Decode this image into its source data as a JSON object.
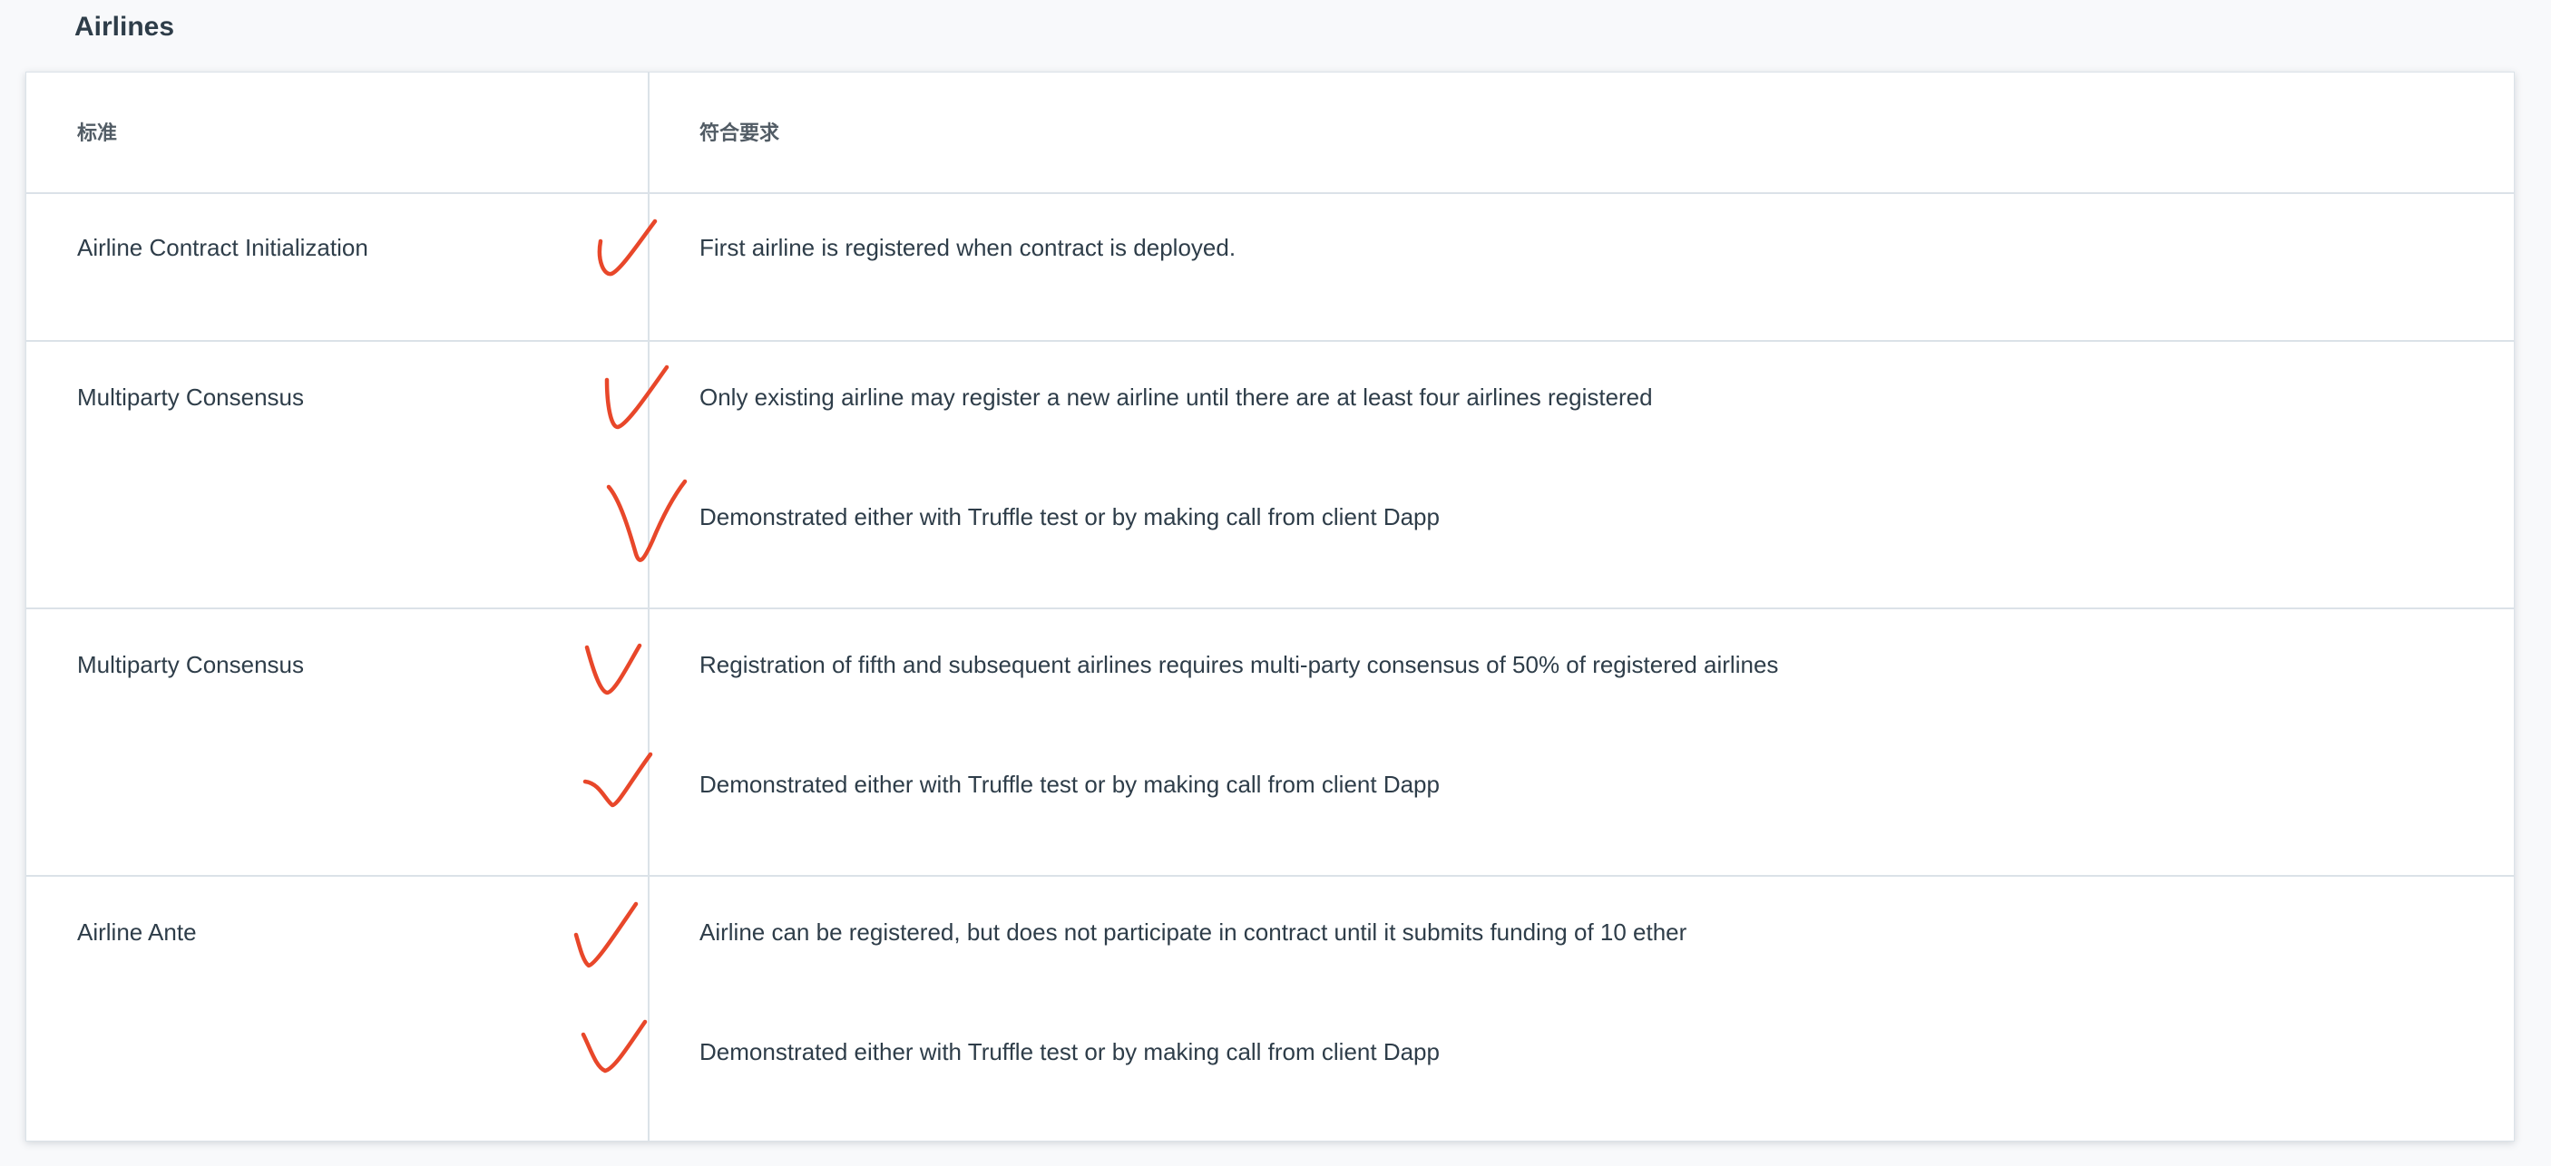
{
  "section": {
    "title": "Airlines"
  },
  "table": {
    "headers": {
      "criteria": "标准",
      "specification": "符合要求"
    },
    "rows": [
      {
        "criteria": "Airline Contract Initialization",
        "specs": [
          "First airline is registered when contract is deployed."
        ]
      },
      {
        "criteria": "Multiparty Consensus",
        "specs": [
          "Only existing airline may register a new airline until there are at least four airlines registered",
          "Demonstrated either with Truffle test or by making call from client Dapp"
        ]
      },
      {
        "criteria": "Multiparty Consensus",
        "specs": [
          "Registration of fifth and subsequent airlines requires multi-party consensus of 50% of registered airlines",
          "Demonstrated either with Truffle test or by making call from client Dapp"
        ]
      },
      {
        "criteria": "Airline Ante",
        "specs": [
          "Airline can be registered, but does not participate in contract until it submits funding of 10 ether",
          "Demonstrated either with Truffle test or by making call from client Dapp"
        ]
      }
    ]
  },
  "annotations": {
    "check_icon": "checkmark-icon",
    "check_color": "#e8472a"
  }
}
